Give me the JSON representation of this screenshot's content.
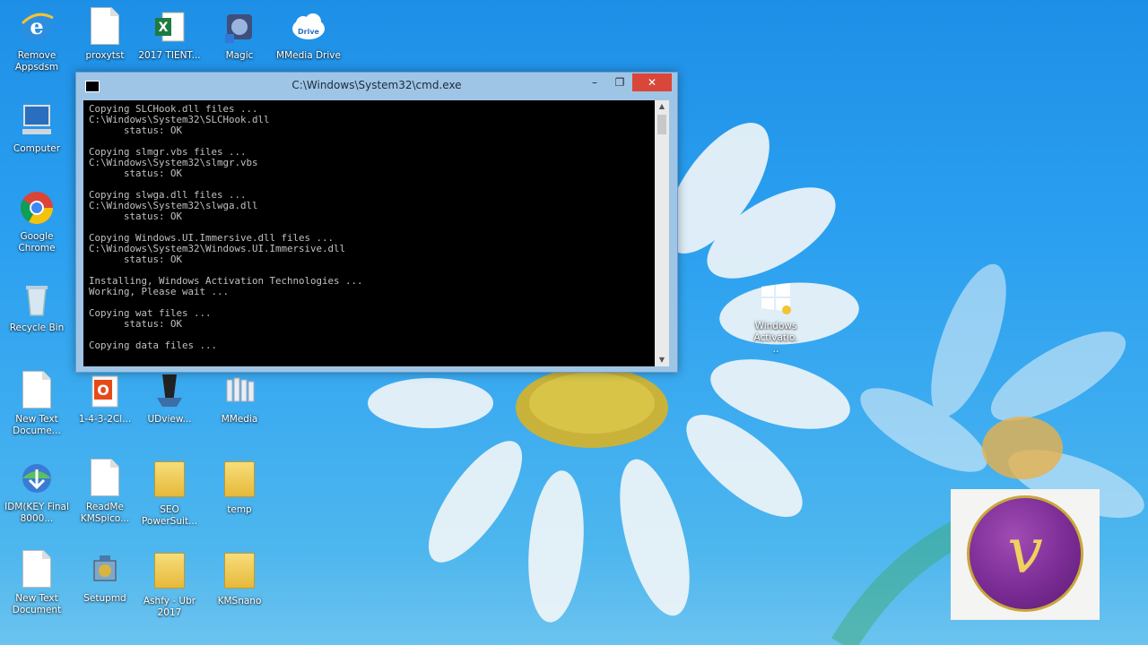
{
  "desktop": {
    "icons": [
      {
        "label": "Remove Appsdsm"
      },
      {
        "label": "proxytst"
      },
      {
        "label": "2017 TIENT..."
      },
      {
        "label": "Magic"
      },
      {
        "label": "MMedia Drive"
      },
      {
        "label": "Computer"
      },
      {
        "label": "Google Chrome"
      },
      {
        "label": "Recycle Bin"
      },
      {
        "label": "New Text Docume..."
      },
      {
        "label": "1-4-3-2Cl..."
      },
      {
        "label": "UDview..."
      },
      {
        "label": "MMedia"
      },
      {
        "label": "IDM(KEY Final 8000..."
      },
      {
        "label": "ReadMe KMSpico..."
      },
      {
        "label": "SEO PowerSuit..."
      },
      {
        "label": "temp"
      },
      {
        "label": "New Text Document"
      },
      {
        "label": "Setupmd"
      },
      {
        "label": "Ashfy - Ubr 2017"
      },
      {
        "label": "KMSnano"
      },
      {
        "label": "Windows Activatio..."
      }
    ],
    "drive_badge": "Drive"
  },
  "cmd": {
    "title": "C:\\Windows\\System32\\cmd.exe",
    "minimize": "–",
    "maximize": "❐",
    "close": "✕",
    "lines": [
      "Copying SLCHook.dll files ...",
      "C:\\Windows\\System32\\SLCHook.dll",
      "      status: OK",
      "",
      "Copying slmgr.vbs files ...",
      "C:\\Windows\\System32\\slmgr.vbs",
      "      status: OK",
      "",
      "Copying slwga.dll files ...",
      "C:\\Windows\\System32\\slwga.dll",
      "      status: OK",
      "",
      "Copying Windows.UI.Immersive.dll files ...",
      "C:\\Windows\\System32\\Windows.UI.Immersive.dll",
      "      status: OK",
      "",
      "Installing, Windows Activation Technologies ...",
      "Working, Please wait ...",
      "",
      "Copying wat files ...",
      "      status: OK",
      "",
      "Copying data files ..."
    ]
  },
  "logo": {
    "letter": "v"
  },
  "colors": {
    "close": "#d9463a",
    "console_bg": "#000000",
    "console_text": "#c0c0c0",
    "titlebar": "#9fc5e6"
  }
}
